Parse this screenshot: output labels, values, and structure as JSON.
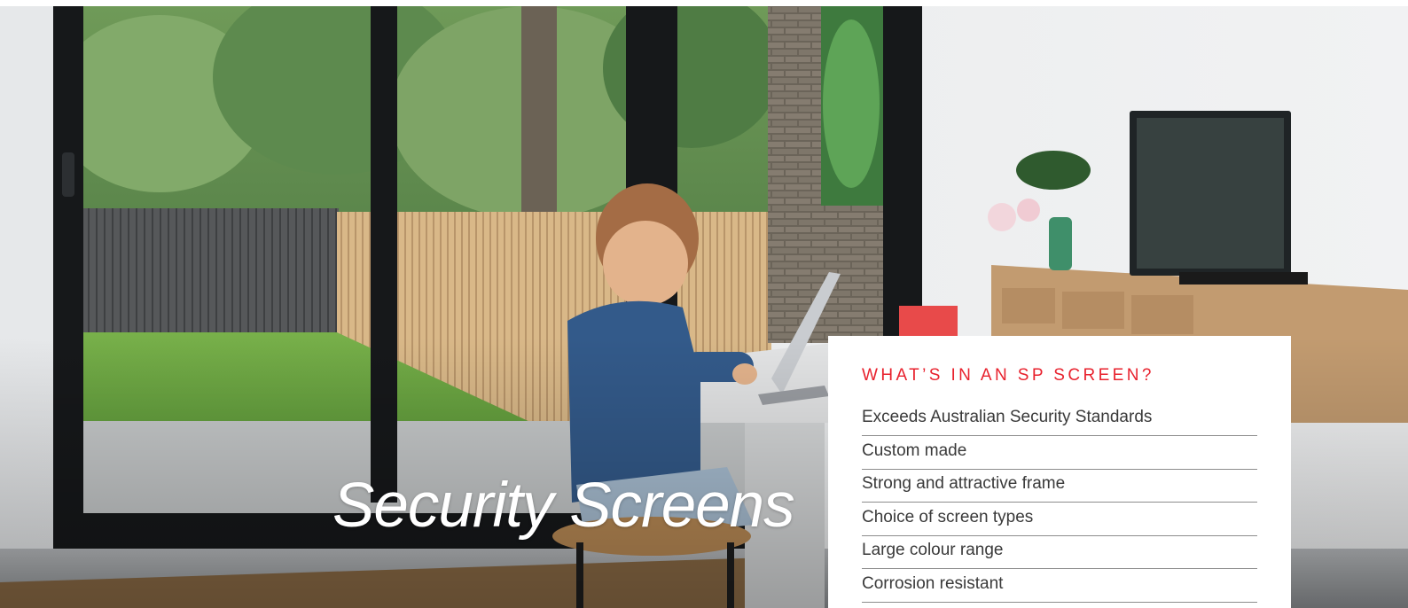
{
  "hero": {
    "title": "Security Screens",
    "image_alt": "Child sitting at a desk using a laptop beside black-framed sliding glass doors opening onto a garden"
  },
  "panel": {
    "heading": "WHAT’S IN AN SP SCREEN?",
    "features": [
      "Exceeds Australian Security Standards",
      "Custom made",
      "Strong and attractive frame",
      "Choice of screen types",
      "Large colour range",
      "Corrosion resistant"
    ]
  },
  "colors": {
    "accent": "#e8222e",
    "text": "#3a3a3a",
    "divider": "#8c8c8c",
    "door_frame": "#16181a"
  }
}
